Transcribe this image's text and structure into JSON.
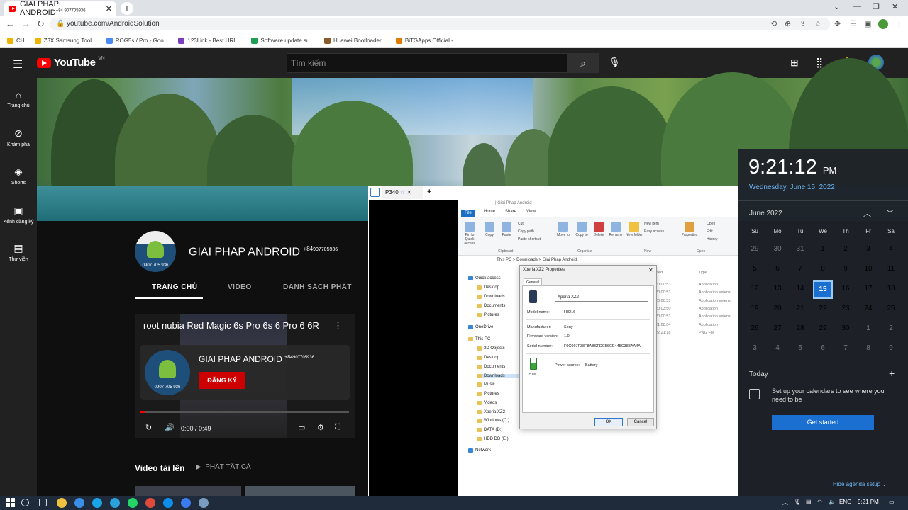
{
  "browser": {
    "tab_title": "GIAI PHAP ANDROID",
    "tab_title_sup": "+84 907705936",
    "url": "youtube.com/AndroidSolution",
    "bookmarks": [
      {
        "label": "CH",
        "color": "#f0b400"
      },
      {
        "label": "Z3X Samsung Tool...",
        "color": "#f0b400"
      },
      {
        "label": "ROG5s / Pro - Goo...",
        "color": "#4a8af4"
      },
      {
        "label": "123Link - Best URL...",
        "color": "#7a3fbf"
      },
      {
        "label": "Software update su...",
        "color": "#1f9d55"
      },
      {
        "label": "Huawei Bootloader...",
        "color": "#8a5a2b"
      },
      {
        "label": "BiTGApps Official -...",
        "color": "#e07b00"
      }
    ]
  },
  "youtube": {
    "logo_text": "YouTube",
    "region": "VN",
    "search_placeholder": "Tìm kiếm",
    "sidebar": [
      {
        "icon": "home-icon",
        "glyph": "⌂",
        "label": "Trang chủ"
      },
      {
        "icon": "explore-icon",
        "glyph": "⊘",
        "label": "Khám phá"
      },
      {
        "icon": "shorts-icon",
        "glyph": "◈",
        "label": "Shorts"
      },
      {
        "icon": "subscriptions-icon",
        "glyph": "▣",
        "label": "Kênh đăng ký"
      },
      {
        "icon": "library-icon",
        "glyph": "▤",
        "label": "Thư viện"
      }
    ],
    "channel": {
      "name": "GIAI PHAP ANDROID",
      "sup": "+84",
      "phone": "907705936",
      "avatar_phone": "0907 705 936",
      "tabs": [
        "TRANG CHỦ",
        "VIDEO",
        "DANH SÁCH PHÁT"
      ]
    },
    "featured": {
      "title": "root nubia Red Magic 6s Pro 6s 6 Pro 6 6R",
      "card_name": "GIAI PHAP ANDROID",
      "card_sup": "+84",
      "card_phone": "907705936",
      "card_avatar_phone": "0907 705 936",
      "subscribe": "ĐĂNG KÝ",
      "time": "0:00 / 0:49",
      "progress": 0.02
    },
    "uploads_label": "Video tải lên",
    "play_all": "PHÁT TẤT CẢ"
  },
  "remote": {
    "tab_label": "P340",
    "explorer": {
      "title": "Giai Phap Android",
      "ribbon_tabs": [
        "File",
        "Home",
        "Share",
        "View"
      ],
      "ribbon_items": [
        "Pin to Quick access",
        "Copy",
        "Paste",
        "Cut",
        "Copy path",
        "Paste shortcut",
        "Move to",
        "Copy to",
        "Delete",
        "Rename",
        "New folder",
        "New item",
        "Easy access",
        "Properties",
        "Open",
        "Edit",
        "History"
      ],
      "groups": [
        "Clipboard",
        "Organize",
        "New",
        "Open"
      ],
      "path": "This PC > Downloads > Giai Phap Android",
      "nav": [
        "Quick access",
        "Desktop",
        "Downloads",
        "Documents",
        "Pictures",
        "OneDrive",
        "This PC",
        "3D Objects",
        "Desktop",
        "Documents",
        "Downloads",
        "Music",
        "Pictures",
        "Videos",
        "Xperia XZ2",
        "Windows (C:)",
        "DATA (D:)",
        "HDD DD (E:)",
        "Network"
      ],
      "col_modified": "ified",
      "col_type": "Type",
      "rows": [
        {
          "date": "20 00:53",
          "type": "Application"
        },
        {
          "date": "20 00:53",
          "type": "Application extensi"
        },
        {
          "date": "20 00:53",
          "type": "Application extensi"
        },
        {
          "date": "20 03:50",
          "type": "Application"
        },
        {
          "date": "20 00:53",
          "type": "Application extensi"
        },
        {
          "date": "21 08:04",
          "type": "Application"
        },
        {
          "date": "22 21:18",
          "type": "PNG File"
        }
      ]
    },
    "dialog": {
      "title": "Xperia XZ2 Properties",
      "tab": "General",
      "device_name": "Xperia XZ2",
      "model_label": "Model name:",
      "model": "H8216",
      "manufacturer_label": "Manufacturer:",
      "manufacturer": "Sony",
      "firmware_label": "Firmware version:",
      "firmware": "1.0",
      "serial_label": "Serial number:",
      "serial": "F9C097F38F8ABSFDC56CE445C388AA4A",
      "power_label": "Power source:",
      "power": "Battery",
      "battery": "51%",
      "ok": "OK",
      "cancel": "Cancel"
    }
  },
  "clock": {
    "time": "9:21:12",
    "ampm": "PM",
    "date": "Wednesday, June 15, 2022",
    "month": "June 2022",
    "dow": [
      "Su",
      "Mo",
      "Tu",
      "We",
      "Th",
      "Fr",
      "Sa"
    ],
    "weeks": [
      [
        "29",
        "30",
        "31",
        "1",
        "2",
        "3",
        "4"
      ],
      [
        "5",
        "6",
        "7",
        "8",
        "9",
        "10",
        "11"
      ],
      [
        "12",
        "13",
        "14",
        "15",
        "16",
        "17",
        "18"
      ],
      [
        "19",
        "20",
        "21",
        "22",
        "23",
        "24",
        "25"
      ],
      [
        "26",
        "27",
        "28",
        "29",
        "30",
        "1",
        "2"
      ],
      [
        "3",
        "4",
        "5",
        "6",
        "7",
        "8",
        "9"
      ]
    ],
    "selected": "15",
    "today_label": "Today",
    "setup_text": "Set up your calendars to see where you need to be",
    "get_started": "Get started",
    "hide_agenda": "Hide agenda setup"
  },
  "taskbar": {
    "lang": "ENG",
    "time": "9:21 PM",
    "apps": [
      {
        "name": "search-icon",
        "color": "#cfd8e3"
      },
      {
        "name": "task-view-icon",
        "color": "#cfd8e3"
      },
      {
        "name": "file-explorer-icon",
        "color": "#f0c040"
      },
      {
        "name": "store-icon",
        "color": "#3a8ee6"
      },
      {
        "name": "skype-icon",
        "color": "#1aa3e8"
      },
      {
        "name": "telegram-icon",
        "color": "#2aa1da"
      },
      {
        "name": "whatsapp-icon",
        "color": "#25d366"
      },
      {
        "name": "chrome-icon",
        "color": "#e04a3a"
      },
      {
        "name": "teamviewer-icon",
        "color": "#0e8ee9"
      },
      {
        "name": "messenger-icon",
        "color": "#3a7bf0"
      },
      {
        "name": "app-icon",
        "color": "#7a9cc0"
      }
    ]
  }
}
